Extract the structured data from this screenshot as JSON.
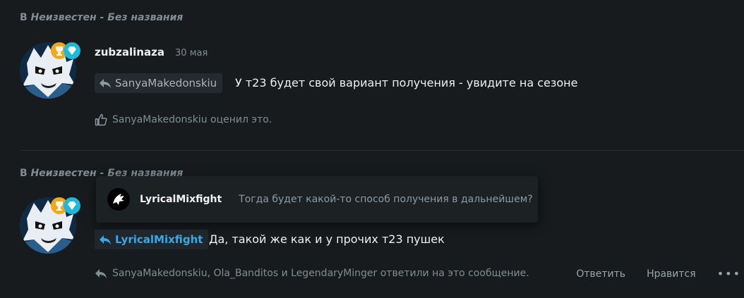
{
  "post1": {
    "context_prefix": "В",
    "context_where": "Неизвестен - Без названия",
    "author": "zubzalinaza",
    "date": "30 мая",
    "reply_to": "SanyaMakedonskiu",
    "message": "У т23 будет свой вариант получения - увидите на сезоне",
    "likes_text": "SanyaMakedonskiu оценил это.",
    "badge_colors": [
      "#f0a81d",
      "#1fb8d8"
    ]
  },
  "post2": {
    "context_prefix": "В",
    "context_where": "Неизвестен - Без названия",
    "reply_to": "LyricalMixfight",
    "message": "Да, такой же как и у прочих т23 пушек",
    "replies_text": "SanyaMakedonskiu, Ola_Banditos и LegendaryMinger ответили на это сообщение."
  },
  "quote_popup": {
    "author": "LyricalMixfight",
    "text": "Тогда будет какой-то способ получения в дальнейшем?"
  },
  "actions": {
    "reply": "Ответить",
    "like": "Нравится",
    "more": "•••"
  },
  "colors": {
    "background": "#171b1e",
    "accent": "#38a8e6",
    "muted": "#7f8d94"
  }
}
